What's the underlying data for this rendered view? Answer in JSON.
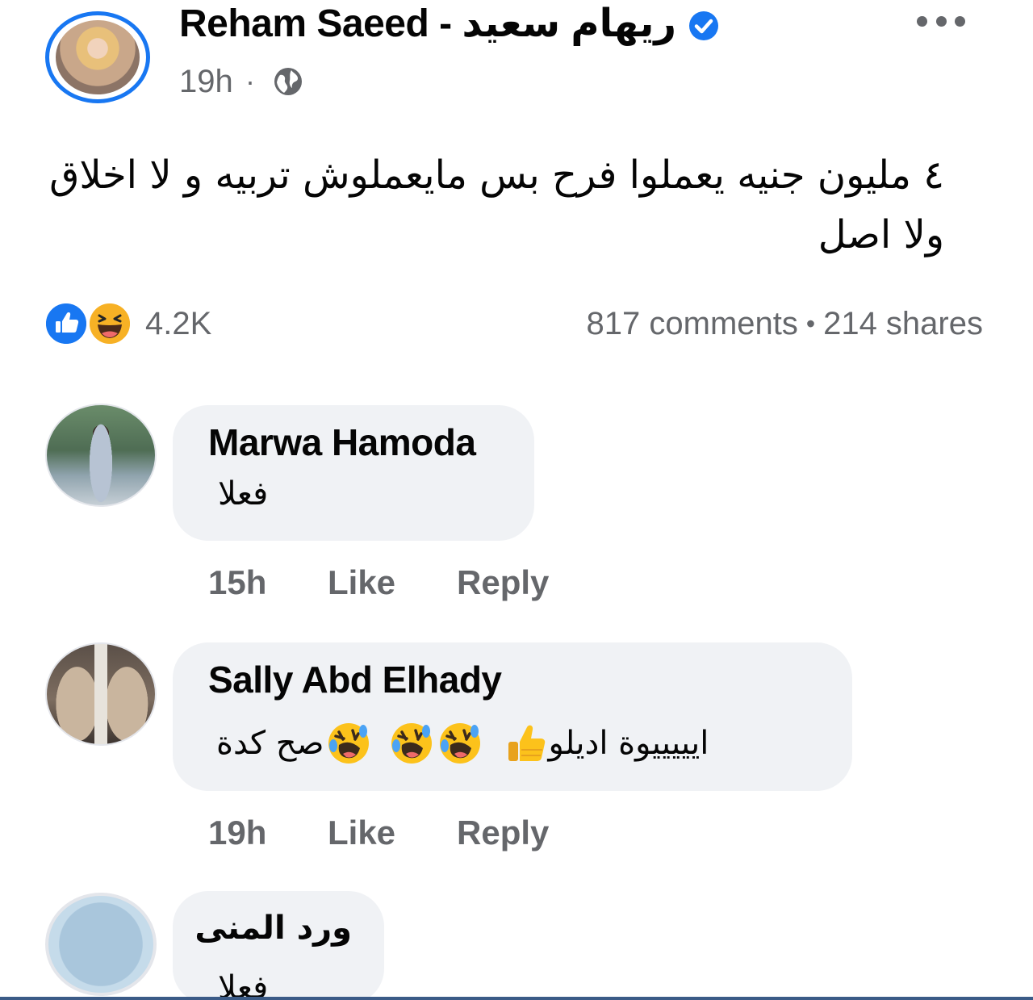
{
  "post": {
    "author": "Reham Saeed - ريهام سعيد",
    "time": "19h",
    "separator": "·",
    "text": "٤ مليون جنيه يعملوا فرح بس مايعملوش تربيه و لا اخلاق ولا اصل",
    "reaction_count": "4.2K",
    "comments": "817 comments",
    "dot": "•",
    "shares": "214 shares"
  },
  "comments": [
    {
      "name": "Marwa Hamoda",
      "text": "فعلا",
      "time": "15h",
      "like": "Like",
      "reply": "Reply"
    },
    {
      "name": "Sally Abd Elhady",
      "text_before": "ايييييوة اديلو",
      "text_after": "صح كدة",
      "time": "19h",
      "like": "Like",
      "reply": "Reply"
    },
    {
      "name": "ورد المنى",
      "text": "فعلا"
    }
  ],
  "icons": {
    "verified": "verified-badge-icon",
    "more": "more-options-icon",
    "privacy": "globe-icon",
    "reaction_like": "like-reaction-icon",
    "reaction_haha": "haha-reaction-icon",
    "thumbs_up": "thumbs-up-emoji",
    "laughing": "rolling-laughing-emoji"
  },
  "colors": {
    "facebook_blue": "#1877f2",
    "secondary_text": "#65676b",
    "bubble": "#f0f2f5",
    "haha_yellow": "#f7b125"
  }
}
